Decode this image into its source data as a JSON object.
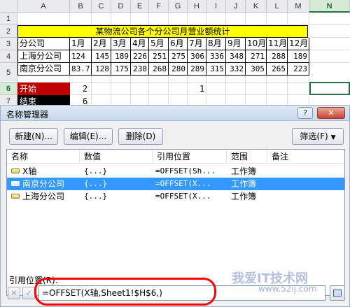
{
  "sheet": {
    "columns": [
      "A",
      "B",
      "C",
      "D",
      "E",
      "F",
      "G",
      "H",
      "I",
      "J",
      "K",
      "L",
      "M",
      "N"
    ],
    "selected_column": "N",
    "rows": [
      "1",
      "2",
      "3",
      "4",
      "5",
      "6",
      "7"
    ],
    "selected_row": "6",
    "title": "某物流公司各个分公司月营业额统计",
    "header": {
      "label": "分公司",
      "months": [
        "1月",
        "2月",
        "3月",
        "4月",
        "5月",
        "6月",
        "7月",
        "8月",
        "9月",
        "10月",
        "11月",
        "12月"
      ]
    },
    "data_rows": [
      {
        "name": "上海分公司",
        "values": [
          "124",
          "145",
          "189",
          "226",
          "251",
          "275",
          "306",
          "336",
          "348",
          "271",
          "288",
          "189"
        ]
      },
      {
        "name": "南京分公司",
        "values": [
          "83.7",
          "128",
          "175",
          "238",
          "268",
          "280",
          "289",
          "315",
          "332",
          "305",
          "265",
          "223"
        ]
      }
    ],
    "start_label": "开始",
    "start_value": "2",
    "end_label": "结束",
    "end_value": "6",
    "h6_value": "1"
  },
  "dialog": {
    "title": "名称管理器",
    "help_label": "?",
    "close_label": "✕",
    "buttons": {
      "new": "新建(N)...",
      "edit": "编辑(E)...",
      "delete": "删除(D)",
      "filter": "筛选(F)"
    },
    "list": {
      "headers": [
        "名称",
        "数值",
        "引用位置",
        "范围",
        "备注"
      ],
      "rows": [
        {
          "name": "X轴",
          "value": "{...}",
          "ref": "=OFFSET(Sh...",
          "scope": "工作簿",
          "note": ""
        },
        {
          "name": "南京分公司",
          "value": "{...}",
          "ref": "=OFFSET(X...",
          "scope": "工作簿",
          "note": ""
        },
        {
          "name": "上海分公司",
          "value": "{...}",
          "ref": "=OFFSET(X...",
          "scope": "工作簿",
          "note": ""
        }
      ],
      "selected_index": 1
    },
    "ref_label": "引用位置(R):",
    "ref_value": "=OFFSET(X轴,Sheet1!$H$6,)",
    "cancel_icon": "✕",
    "confirm_icon": "✓"
  },
  "watermark": {
    "text": "我爱IT技术网",
    "url": "www.52ij.com"
  },
  "colors": {
    "title_band": "#ffff00",
    "start_cell": "#c00000",
    "end_cell": "#000000",
    "selection": "#3399ff",
    "highlight": "#ff0000",
    "active_cell_border": "#217346"
  },
  "icons": {
    "name_row": "named-range-icon",
    "collapse": "collapse-dialog-icon",
    "filter_dropdown": "chevron-down-icon"
  }
}
